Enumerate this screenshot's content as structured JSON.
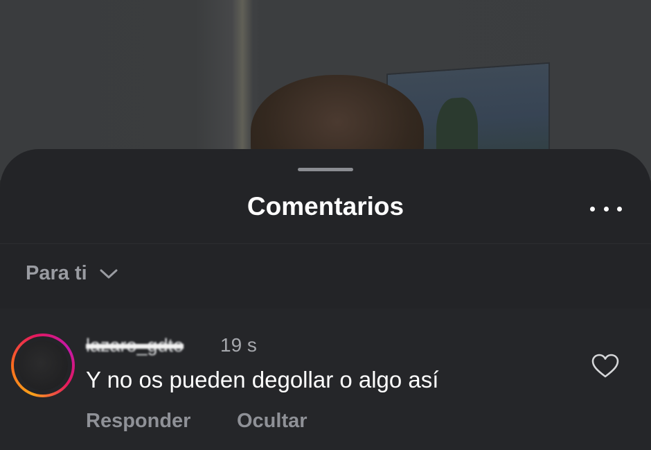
{
  "sheet": {
    "title": "Comentarios",
    "filter": {
      "label": "Para ti"
    }
  },
  "icons": {
    "more": "more-horizontal-icon",
    "filter_chevron": "chevron-down-icon",
    "like": "heart-icon"
  },
  "comment": {
    "username": "lazaro_gdto",
    "time": "19 s",
    "text": "Y no os pueden degollar o algo así",
    "actions": {
      "reply": "Responder",
      "hide": "Ocultar"
    }
  },
  "colors": {
    "sheet_bg": "#232427",
    "text_primary": "#ffffff",
    "text_secondary": "#9a9ca2",
    "story_ring_start": "#f9a21a",
    "story_ring_end": "#c418a8"
  }
}
